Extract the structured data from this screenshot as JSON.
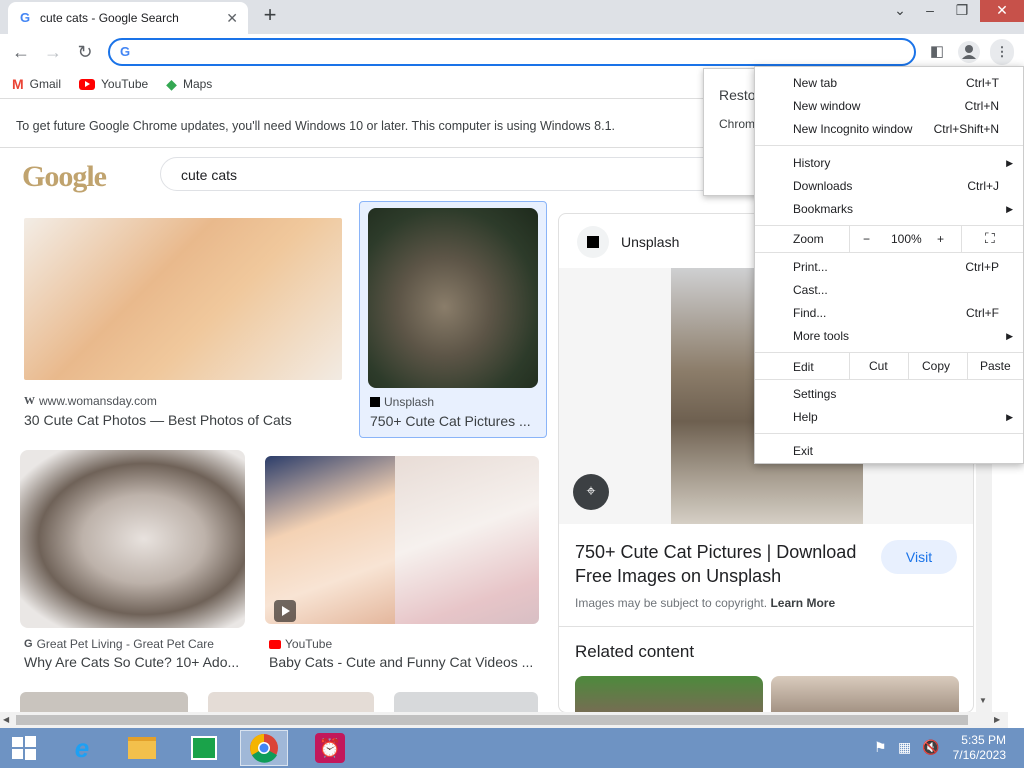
{
  "tab": {
    "title": "cute cats - Google Search",
    "favicon": "G"
  },
  "bookmarks": [
    {
      "label": "Gmail",
      "icon": "gmail-icon"
    },
    {
      "label": "YouTube",
      "icon": "youtube-icon"
    },
    {
      "label": "Maps",
      "icon": "maps-icon"
    }
  ],
  "infobar": {
    "text": "To get future Google Chrome updates, you'll need Windows 10 or later. This computer is using Windows 8.1."
  },
  "search": {
    "logo": "Google",
    "query": "cute cats"
  },
  "results": [
    {
      "source": "www.womansday.com",
      "title": "30 Cute Cat Photos — Best Photos of Cats"
    },
    {
      "source": "Unsplash",
      "title": "750+ Cute Cat Pictures ..."
    },
    {
      "source": "Great Pet Living - Great Pet Care",
      "title": "Why Are Cats So Cute? 10+ Ado..."
    },
    {
      "source": "YouTube",
      "title": "Baby Cats - Cute and Funny Cat Videos ..."
    }
  ],
  "preview": {
    "source": "Unsplash",
    "title_line1": "750+ Cute Cat Pictures | Download",
    "title_line2": "Free Images on Unsplash",
    "visit": "Visit",
    "copyright": "Images may be subject to copyright.",
    "learn_more": "Learn More",
    "related": "Related content"
  },
  "popup": {
    "line1": "Resto",
    "line2": "Chrom"
  },
  "menu": {
    "new_tab": "New tab",
    "new_tab_sc": "Ctrl+T",
    "new_window": "New window",
    "new_window_sc": "Ctrl+N",
    "incognito": "New Incognito window",
    "incognito_sc": "Ctrl+Shift+N",
    "history": "History",
    "downloads": "Downloads",
    "downloads_sc": "Ctrl+J",
    "bookmarks": "Bookmarks",
    "zoom": "Zoom",
    "zoom_minus": "−",
    "zoom_value": "100%",
    "zoom_plus": "+",
    "print": "Print...",
    "print_sc": "Ctrl+P",
    "cast": "Cast...",
    "find": "Find...",
    "find_sc": "Ctrl+F",
    "more_tools": "More tools",
    "edit": "Edit",
    "cut": "Cut",
    "copy": "Copy",
    "paste": "Paste",
    "settings": "Settings",
    "help": "Help",
    "exit": "Exit"
  },
  "clock": {
    "time": "5:35 PM",
    "date": "7/16/2023"
  }
}
